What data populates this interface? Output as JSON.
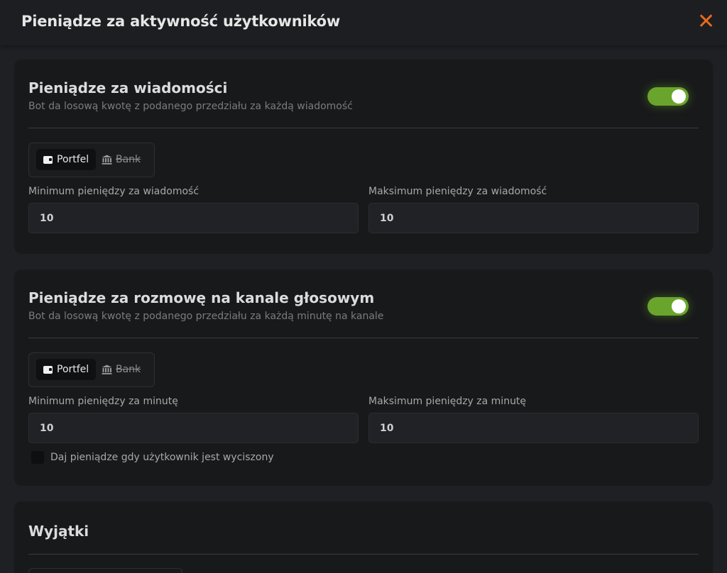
{
  "header": {
    "title": "Pieniądze za aktywność użytkowników",
    "close_glyph": "✕"
  },
  "accent_color": "#ea6a1b",
  "toggle_color": "#69a52c",
  "messages": {
    "title": "Pieniądze za wiadomości",
    "description": "Bot da losową kwotę z podanego przedziału za każdą wiadomość",
    "enabled": true,
    "wallet_option": "Portfel",
    "bank_option": "Bank",
    "selected": "Portfel",
    "min_label": "Minimum pieniędzy za wiadomość",
    "min_value": "10",
    "max_label": "Maksimum pieniędzy za wiadomość",
    "max_value": "10"
  },
  "voice": {
    "title": "Pieniądze za rozmowę na kanale głosowym",
    "description": "Bot da losową kwotę z podanego przedziału za każdą minutę na kanale",
    "enabled": true,
    "wallet_option": "Portfel",
    "bank_option": "Bank",
    "selected": "Portfel",
    "min_label": "Minimum pieniędzy za minutę",
    "min_value": "10",
    "max_label": "Maksimum pieniędzy za minutę",
    "max_value": "10",
    "muted_checkbox_label": "Daj pieniądze gdy użytkownik jest wyciszony",
    "muted_checked": false
  },
  "exceptions": {
    "title": "Wyjątki"
  }
}
